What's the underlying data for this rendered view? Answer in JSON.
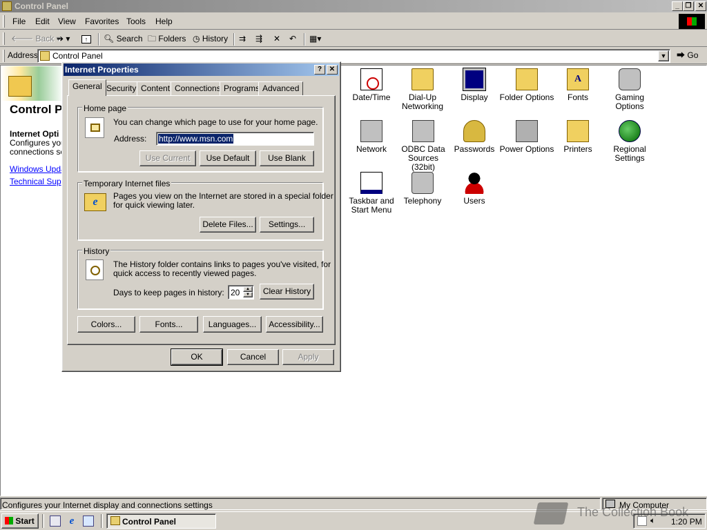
{
  "window": {
    "title": "Control Panel"
  },
  "menu": [
    "File",
    "Edit",
    "View",
    "Favorites",
    "Tools",
    "Help"
  ],
  "toolbar": {
    "back": "Back",
    "search": "Search",
    "folders": "Folders",
    "history": "History"
  },
  "addressbar": {
    "label": "Address",
    "value": "Control Panel",
    "go": "Go"
  },
  "leftpane": {
    "title": "Control P",
    "section_title": "Internet Opti",
    "desc_line1": "Configures your",
    "desc_line2": "connections set",
    "link1": "Windows Updat",
    "link2": "Technical Suppo"
  },
  "icons": [
    {
      "label1": "Date/Time",
      "label2": "",
      "icon": "clock-calendar-icon"
    },
    {
      "label1": "Dial-Up",
      "label2": "Networking",
      "icon": "dialup-folder-icon"
    },
    {
      "label1": "Display",
      "label2": "",
      "icon": "monitor-icon"
    },
    {
      "label1": "Folder Options",
      "label2": "",
      "icon": "folder-options-icon"
    },
    {
      "label1": "Fonts",
      "label2": "",
      "icon": "fonts-folder-icon"
    },
    {
      "label1": "Gaming",
      "label2": "Options",
      "icon": "joystick-icon"
    },
    {
      "label1": "Network",
      "label2": "",
      "icon": "network-icon"
    },
    {
      "label1": "ODBC Data",
      "label2": "Sources (32bit)",
      "icon": "odbc-icon"
    },
    {
      "label1": "Passwords",
      "label2": "",
      "icon": "keys-icon"
    },
    {
      "label1": "Power Options",
      "label2": "",
      "icon": "battery-plug-icon"
    },
    {
      "label1": "Printers",
      "label2": "",
      "icon": "printers-folder-icon"
    },
    {
      "label1": "Regional",
      "label2": "Settings",
      "icon": "globe-icon"
    },
    {
      "label1": "Taskbar and",
      "label2": "Start Menu",
      "icon": "taskbar-icon"
    },
    {
      "label1": "Telephony",
      "label2": "",
      "icon": "telephone-icon"
    },
    {
      "label1": "Users",
      "label2": "",
      "icon": "users-icon"
    }
  ],
  "dialog": {
    "title": "Internet Properties",
    "tabs": [
      "General",
      "Security",
      "Content",
      "Connections",
      "Programs",
      "Advanced"
    ],
    "homepage": {
      "group": "Home page",
      "text": "You can change which page to use for your home page.",
      "address_label": "Address:",
      "address_value": "http://www.msn.com",
      "use_current": "Use Current",
      "use_default": "Use Default",
      "use_blank": "Use Blank"
    },
    "temp": {
      "group": "Temporary Internet files",
      "text1": "Pages you view on the Internet are stored in a special folder",
      "text2": "for quick viewing later.",
      "delete": "Delete Files...",
      "settings": "Settings..."
    },
    "history": {
      "group": "History",
      "text1": "The History folder contains links to pages you've visited, for",
      "text2": "quick access to recently viewed pages.",
      "days_label": "Days to keep pages in history:",
      "days_value": "20",
      "clear": "Clear History"
    },
    "bottom": {
      "colors": "Colors...",
      "fonts": "Fonts...",
      "languages": "Languages...",
      "accessibility": "Accessibility..."
    },
    "ok": "OK",
    "cancel": "Cancel",
    "apply": "Apply"
  },
  "statusbar": {
    "text": "Configures your Internet display and connections settings",
    "zone": "My Computer"
  },
  "taskbar": {
    "start": "Start",
    "task": "Control Panel",
    "clock": "1:20 PM"
  },
  "watermark": "The Collection Book"
}
